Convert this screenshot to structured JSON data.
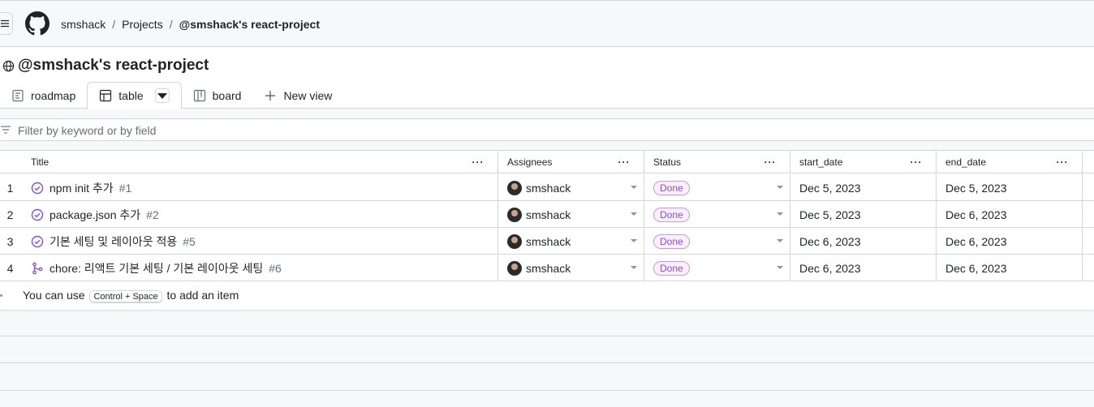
{
  "breadcrumb": {
    "owner": "smshack",
    "sep": "/",
    "projects": "Projects",
    "current": "@smshack's react-project"
  },
  "project": {
    "title": "@smshack's react-project"
  },
  "tabs": [
    {
      "label": "roadmap",
      "icon": "roadmap-icon"
    },
    {
      "label": "table",
      "icon": "table-icon"
    },
    {
      "label": "board",
      "icon": "board-icon"
    }
  ],
  "new_view_label": "New view",
  "filter": {
    "placeholder": "Filter by keyword or by field"
  },
  "columns": {
    "title": "Title",
    "assignees": "Assignees",
    "status": "Status",
    "start_date": "start_date",
    "end_date": "end_date",
    "menu": "···"
  },
  "rows": [
    {
      "n": "1",
      "title": "npm init 추가",
      "num": "#1",
      "assignee": "smshack",
      "status": "Done",
      "start": "Dec 5, 2023",
      "end": "Dec 5, 2023",
      "icon": "issue-closed-icon"
    },
    {
      "n": "2",
      "title": "package.json 추가",
      "num": "#2",
      "assignee": "smshack",
      "status": "Done",
      "start": "Dec 5, 2023",
      "end": "Dec 6, 2023",
      "icon": "issue-closed-icon"
    },
    {
      "n": "3",
      "title": "기본 세팅 및 레이아웃 적용",
      "num": "#5",
      "assignee": "smshack",
      "status": "Done",
      "start": "Dec 6, 2023",
      "end": "Dec 6, 2023",
      "icon": "issue-closed-icon"
    },
    {
      "n": "4",
      "title": "chore: 리액트 기본 세팅 / 기본 레이아웃 세팅",
      "num": "#6",
      "assignee": "smshack",
      "status": "Done",
      "start": "Dec 6, 2023",
      "end": "Dec 6, 2023",
      "icon": "pull-request-merged-icon"
    }
  ],
  "add_item": {
    "prefix": "You can use",
    "kbd": "Control + Space",
    "suffix": "to add an item"
  },
  "colors": {
    "done_badge": "#8250df",
    "border": "#d0d7de"
  }
}
